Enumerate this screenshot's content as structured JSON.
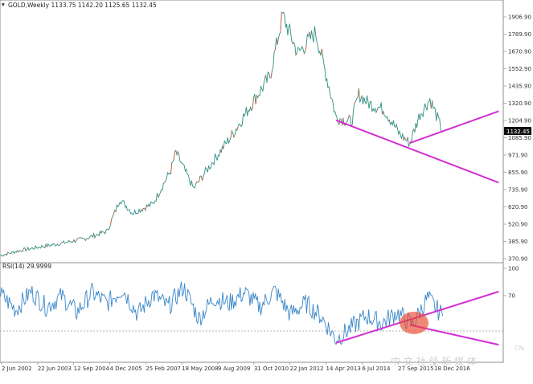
{
  "window": {
    "main_title": "GOLD,Weekly  1133.75 1142.20 1125.65 1132.45",
    "rsi_title": "RSI(14) 29.9999",
    "watermark": "中 文 社 经 新 媒 体",
    "watermark_tail": "CN"
  },
  "colors": {
    "price_line": "#2f8f82",
    "price_up": "#e0603a",
    "rsi_line": "#3a86c8",
    "trend_line": "#d22fd2",
    "grid": "#8c8c8c",
    "bg": "#ffffff",
    "current_price_box": "#111111",
    "watermark_logo": "#e8452c"
  },
  "chart_data": [
    {
      "type": "line",
      "title": "GOLD,Weekly",
      "ohlc_header": [
        "1133.75",
        "1142.20",
        "1125.65",
        "1132.45"
      ],
      "current_price": 1132.45,
      "current_price_label": "1132.45",
      "y_ticks": [
        "1906.90",
        "1789.90",
        "1670.90",
        "1552.90",
        "1435.90",
        "1320.90",
        "1204.90",
        "1085.90",
        "971.90",
        "855.90",
        "735.90",
        "620.90",
        "520.90",
        "385.90",
        "370.90"
      ],
      "x_ticks": [
        "2 Jun 2002",
        "22 Jun 2003",
        "12 Sep 2004",
        "4 Dec 2005",
        "25 Feb 2007",
        "18 May 2008",
        "9 Aug 2009",
        "31 Oct 2010",
        "22 Jan 2012",
        "14 Apr 2013",
        "6 Jul 2014",
        "27 Sep 2015",
        "18 Dec 2016"
      ],
      "series": [
        {
          "x": [
            "2002-06",
            "2003-01",
            "2003-09",
            "2004-06",
            "2005-03",
            "2005-12",
            "2006-05",
            "2006-10",
            "2007-06",
            "2008-01",
            "2008-03",
            "2008-10",
            "2009-06",
            "2010-01",
            "2010-10",
            "2011-04",
            "2011-09",
            "2012-03",
            "2012-10",
            "2013-04",
            "2013-06",
            "2013-12",
            "2014-03",
            "2014-07",
            "2015-01",
            "2015-07",
            "2015-11",
            "2016-03",
            "2016-07",
            "2016-12"
          ],
          "values": [
            320,
            350,
            375,
            400,
            430,
            480,
            690,
            600,
            660,
            880,
            1000,
            760,
            950,
            1110,
            1350,
            1500,
            1900,
            1650,
            1790,
            1380,
            1230,
            1200,
            1380,
            1320,
            1280,
            1120,
            1060,
            1250,
            1350,
            1132
          ]
        }
      ],
      "trend_lines": [
        {
          "from": [
            "2013-06",
            1210
          ],
          "to": [
            "2018-10",
            800
          ]
        },
        {
          "from": [
            "2015-11",
            1060
          ],
          "to": [
            "2018-10",
            1270
          ]
        }
      ]
    },
    {
      "type": "line",
      "title": "RSI(14)",
      "current_value": 29.9999,
      "y_ticks": [
        "100",
        "70"
      ],
      "x": [
        "2002-06",
        "2002-12",
        "2003-06",
        "2003-12",
        "2004-06",
        "2004-12",
        "2005-06",
        "2005-12",
        "2006-06",
        "2006-12",
        "2007-06",
        "2007-12",
        "2008-06",
        "2008-12",
        "2009-06",
        "2009-12",
        "2010-06",
        "2010-12",
        "2011-06",
        "2011-12",
        "2012-06",
        "2012-12",
        "2013-06",
        "2013-12",
        "2014-06",
        "2014-12",
        "2015-06",
        "2015-12",
        "2016-06",
        "2016-12"
      ],
      "values": [
        72,
        55,
        75,
        58,
        70,
        52,
        74,
        62,
        78,
        50,
        72,
        58,
        80,
        45,
        68,
        62,
        74,
        58,
        76,
        50,
        62,
        48,
        22,
        35,
        48,
        40,
        52,
        38,
        68,
        48
      ],
      "trend_lines": [
        {
          "from": [
            "2013-06",
            18
          ],
          "to": [
            "2018-10",
            75
          ]
        },
        {
          "from": [
            "2015-11",
            38
          ],
          "to": [
            "2018-10",
            16
          ]
        }
      ]
    }
  ]
}
